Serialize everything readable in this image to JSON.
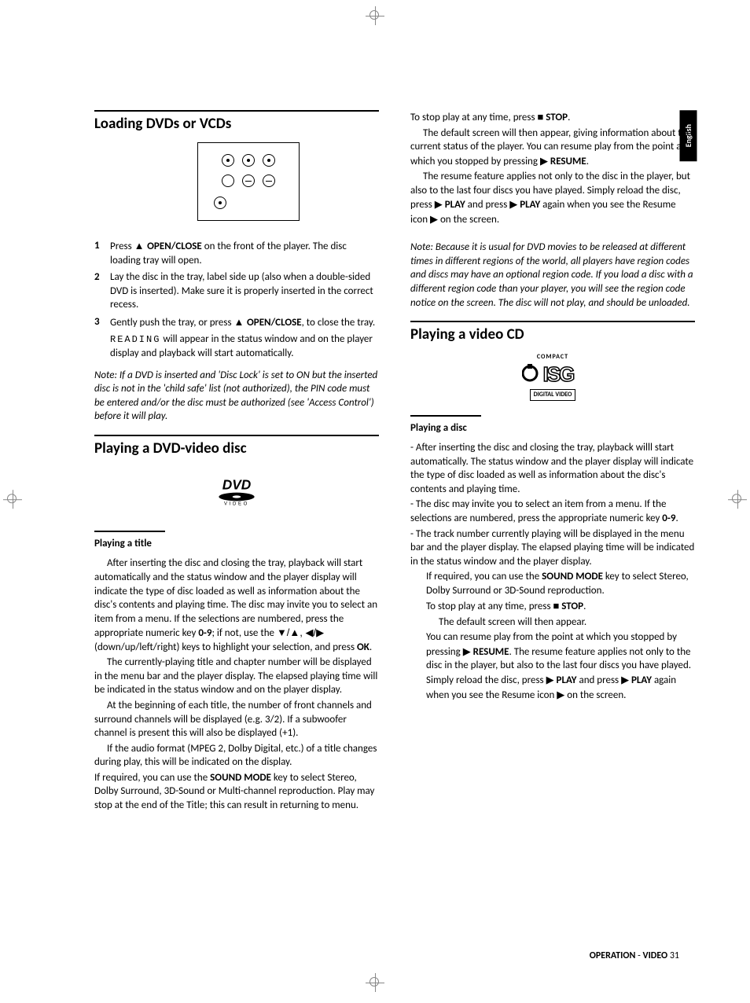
{
  "lang_tab": "English",
  "left": {
    "h1_loading": "Loading DVDs or VCDs",
    "steps": [
      {
        "num": "1",
        "pre": "Press ",
        "btn": "OPEN/CLOSE",
        "post": " on the front of the player. The disc loading tray will open."
      },
      {
        "num": "2",
        "text": "Lay the disc in the tray, label side up (also when a double-sided DVD is inserted). Make sure it is properly inserted in the correct recess."
      },
      {
        "num": "3",
        "pre": "Gently push the tray, or press ",
        "btn": "OPEN/CLOSE",
        "post": ", to close the tray."
      }
    ],
    "reading_status": "READING",
    "reading_tail": " will appear in the status window and on the player display and playback will start automatically.",
    "note1": "Note: If a DVD is inserted and 'Disc Lock' is set to ON but the inserted disc is not in the 'child safe' list (not authorized), the PIN code must be entered and/or the disc must be authorized (see 'Access Control') before it will play.",
    "h1_dvd": "Playing a DVD-video disc",
    "dvd_logo_text": "VIDEO",
    "sub_title": "Playing a title",
    "p1a": "After inserting the disc and closing the tray, playback will start automatically and the status window and the player display will indicate the type of disc loaded as well as information about the disc's contents and playing time. The disc may invite you to select an item from a menu. If the selections are numbered, press the appropriate numeric key ",
    "p1_key": "0-9",
    "p1b": "; if not, use the ",
    "p1_arrows": "▼/▲, ◀/▶",
    "p1c": " (down/up/left/right) keys to highlight your selection, and press ",
    "p1_ok": "OK",
    "p1d": ".",
    "p2": "The currently-playing title and chapter number will be displayed in the menu bar and the player display. The elapsed playing time will be indicated in the status window and on the player display.",
    "p3": "At the beginning of each title, the number of front channels and surround channels will be displayed (e.g. 3/2). If a subwoofer channel is present this will also be displayed (+1).",
    "p4": "If the audio format (MPEG 2, Dolby Digital, etc.) of a title changes during play, this will be indicated on the display.",
    "p5a": "If required, you can use the ",
    "p5_sm": "SOUND MODE",
    "p5b": " key to select Stereo, Dolby Surround, 3D-Sound or Multi-channel reproduction. Play may stop at the end of the Title; this can result in returning to menu."
  },
  "right": {
    "r1a": "To stop play at any time, press ",
    "stop_sym": "■",
    "r1_stop": " STOP",
    "r1b": ".",
    "r2": "The default screen will then appear, giving information about the current status of the player. You can resume play from the point at which you stopped by pressing ",
    "resume_sym": "▶",
    "r2_resume": " RESUME",
    "r2b": ".",
    "r3a": "The resume feature applies not only to the disc in the player, but also to the last four discs you have played. Simply reload the disc, press ",
    "play_sym": "▶",
    "r3_play": " PLAY",
    "r3b": " and press ",
    "r3_play2": " PLAY",
    "r3c": " again when you see the Resume icon ",
    "r3d": " on the screen.",
    "note2": "Note: Because it is usual for DVD movies to be released at different times in different regions of the world, all players have region codes and discs may have an optional region code. If you load a disc with a different region code than your player, you will see the region code notice on the screen. The disc will not play, and should be unloaded.",
    "h1_vcd": "Playing a video CD",
    "cd_top": "COMPACT",
    "cd_mid": "disc",
    "cd_bottom": "DIGITAL VIDEO",
    "sub_disc": "Playing a disc",
    "d1": "- After inserting the disc and closing the tray, playback willl start automatically. The status window and the player display will indicate the type of disc loaded as well as information about the disc's contents and playing time.",
    "d2a": "- The disc may invite you to select an item from a menu. If the selections are numbered, press the appropriate numeric key ",
    "d2_key": "0-9",
    "d2b": ".",
    "d3": "- The track number currently playing will be displayed in the menu bar and the player display. The elapsed playing time will be indicated in the status window and the player display.",
    "d4a": "If required, you can use the ",
    "d4_sm": "SOUND MODE",
    "d4b": " key to select Stereo, Dolby Surround or 3D-Sound reproduction.",
    "d5a": "To stop play at any time, press ",
    "d5_stop": " STOP",
    "d5b": ".",
    "d6": "The default screen will then appear.",
    "d7a": "You can resume play from the point at which you stopped by pressing ",
    "d7_resume": " RESUME",
    "d7b": ". The resume feature applies not only to the disc in the player, but also to the last four discs you have played. Simply reload the disc, press ",
    "d7_play": " PLAY",
    "d7c": " and press ",
    "d7_play2": " PLAY",
    "d7d": " again when you see the Resume icon ",
    "d7e": " on the screen."
  },
  "footer": {
    "section": "OPERATION",
    "dash": " - ",
    "sub": "VIDEO",
    "page": " 31"
  }
}
